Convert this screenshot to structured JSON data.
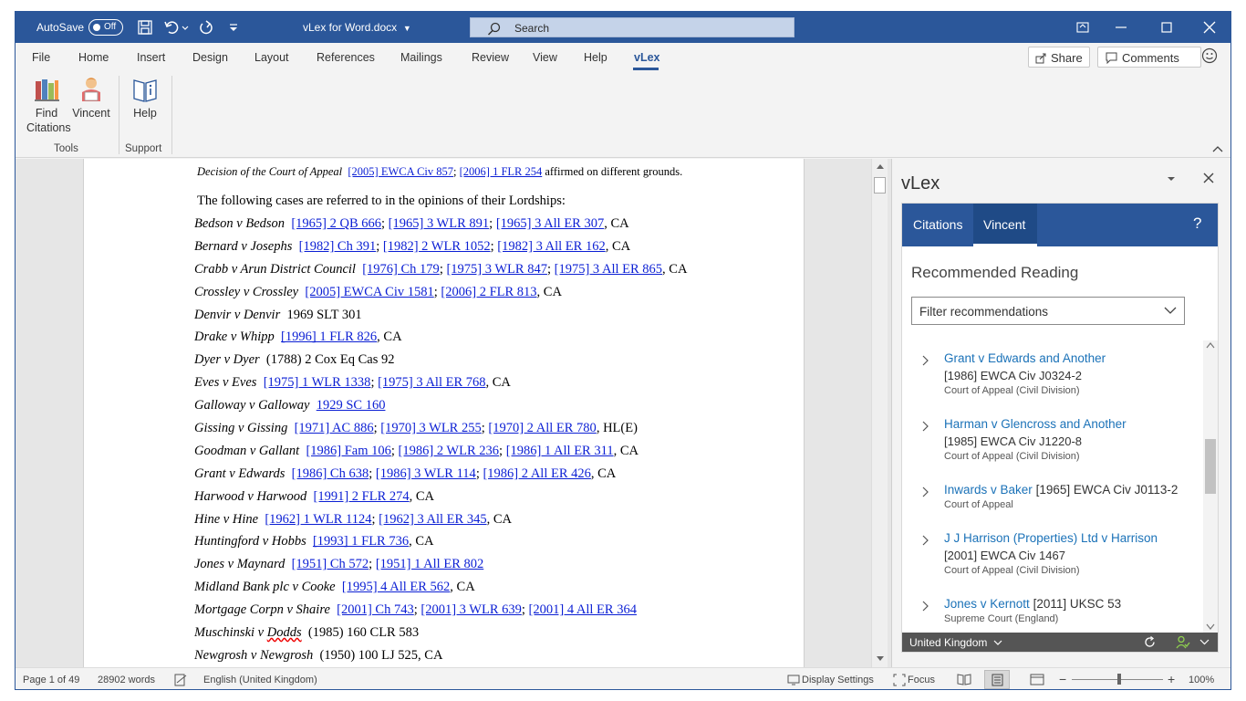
{
  "titlebar": {
    "autosave_label": "AutoSave",
    "autosave_state": "Off",
    "doc_title": "vLex for Word.docx",
    "search_placeholder": "Search"
  },
  "menu": {
    "items": [
      "File",
      "Home",
      "Insert",
      "Design",
      "Layout",
      "References",
      "Mailings",
      "Review",
      "View",
      "Help",
      "vLex"
    ],
    "active": "vLex",
    "share_label": "Share",
    "comments_label": "Comments"
  },
  "ribbon": {
    "find_citations_line1": "Find",
    "find_citations_line2": "Citations",
    "vincent_label": "Vincent",
    "help_label": "Help",
    "group_tools": "Tools",
    "group_support": "Support"
  },
  "document": {
    "decision_prefix": "Decision of the Court of Appeal",
    "decision_cit1": "[2005] EWCA Civ 857",
    "decision_sep": ";",
    "decision_cit2": "[2006] 1 FLR 254",
    "decision_suffix": "affirmed on different grounds.",
    "intro": "The following cases are referred to in the opinions of their Lordships:",
    "cases": [
      {
        "name": "Bedson v Bedson",
        "parts": [
          {
            "t": "[1965] 2 QB 666",
            "link": true
          },
          {
            "t": "; "
          },
          {
            "t": "[1965] 3 WLR 891",
            "link": true
          },
          {
            "t": "; "
          },
          {
            "t": "[1965] 3 All ER 307",
            "link": true
          },
          {
            "t": ", CA"
          }
        ]
      },
      {
        "name": "Bernard v Josephs",
        "parts": [
          {
            "t": "[1982] Ch 391",
            "link": true
          },
          {
            "t": "; "
          },
          {
            "t": "[1982] 2 WLR 1052",
            "link": true
          },
          {
            "t": "; "
          },
          {
            "t": "[1982] 3 All ER 162",
            "link": true
          },
          {
            "t": ", CA"
          }
        ]
      },
      {
        "name": "Crabb v Arun District Council",
        "parts": [
          {
            "t": "[1976] Ch 179",
            "link": true
          },
          {
            "t": "; "
          },
          {
            "t": "[1975] 3 WLR 847",
            "link": true
          },
          {
            "t": "; "
          },
          {
            "t": "[1975] 3 All ER 865",
            "link": true
          },
          {
            "t": ", CA"
          }
        ]
      },
      {
        "name": "Crossley v Crossley",
        "parts": [
          {
            "t": "[2005] EWCA Civ 1581",
            "link": true
          },
          {
            "t": "; "
          },
          {
            "t": "[2006] 2 FLR 813",
            "link": true
          },
          {
            "t": ", CA"
          }
        ]
      },
      {
        "name": "Denvir v Denvir",
        "parts": [
          {
            "t": "1969 SLT 301"
          }
        ]
      },
      {
        "name": "Drake v Whipp",
        "parts": [
          {
            "t": "[1996] 1 FLR 826",
            "link": true
          },
          {
            "t": ", CA"
          }
        ]
      },
      {
        "name": "Dyer v Dyer",
        "parts": [
          {
            "t": "(1788) 2 Cox Eq Cas 92"
          }
        ]
      },
      {
        "name": "Eves v Eves",
        "parts": [
          {
            "t": "[1975] 1 WLR 1338",
            "link": true
          },
          {
            "t": "; "
          },
          {
            "t": "[1975] 3 All ER 768",
            "link": true
          },
          {
            "t": ", CA"
          }
        ]
      },
      {
        "name": "Galloway v Galloway",
        "parts": [
          {
            "t": "1929 SC 160",
            "link": true
          }
        ]
      },
      {
        "name": "Gissing v Gissing",
        "parts": [
          {
            "t": "[1971] AC 886",
            "link": true
          },
          {
            "t": "; "
          },
          {
            "t": "[1970] 3 WLR 255",
            "link": true
          },
          {
            "t": "; "
          },
          {
            "t": "[1970] 2 All ER 780",
            "link": true
          },
          {
            "t": ", HL(E)"
          }
        ]
      },
      {
        "name": "Goodman v Gallant",
        "parts": [
          {
            "t": "[1986] Fam 106",
            "link": true
          },
          {
            "t": "; "
          },
          {
            "t": "[1986] 2 WLR 236",
            "link": true
          },
          {
            "t": "; "
          },
          {
            "t": "[1986] 1 All ER 311",
            "link": true
          },
          {
            "t": ", CA"
          }
        ]
      },
      {
        "name": "Grant v Edwards",
        "parts": [
          {
            "t": "[1986] Ch 638",
            "link": true
          },
          {
            "t": "; "
          },
          {
            "t": "[1986] 3 WLR 114",
            "link": true
          },
          {
            "t": "; "
          },
          {
            "t": "[1986] 2 All ER 426",
            "link": true
          },
          {
            "t": ", CA"
          }
        ]
      },
      {
        "name": "Harwood v Harwood",
        "parts": [
          {
            "t": "[1991] 2 FLR 274",
            "link": true
          },
          {
            "t": ", CA"
          }
        ]
      },
      {
        "name": "Hine v Hine",
        "parts": [
          {
            "t": "[1962] 1 WLR 1124",
            "link": true
          },
          {
            "t": "; "
          },
          {
            "t": "[1962] 3 All ER 345",
            "link": true
          },
          {
            "t": ", CA"
          }
        ]
      },
      {
        "name": "Huntingford v Hobbs",
        "parts": [
          {
            "t": "[1993] 1 FLR 736",
            "link": true
          },
          {
            "t": ", CA"
          }
        ]
      },
      {
        "name": "Jones v Maynard",
        "parts": [
          {
            "t": "[1951] Ch 572",
            "link": true
          },
          {
            "t": "; "
          },
          {
            "t": "[1951] 1 All ER 802",
            "link": true
          }
        ]
      },
      {
        "name": "Midland Bank plc v Cooke",
        "parts": [
          {
            "t": "[1995] 4 All ER 562",
            "link": true
          },
          {
            "t": ", CA"
          }
        ]
      },
      {
        "name": "Mortgage Corpn v Shaire",
        "parts": [
          {
            "t": "[2001] Ch 743",
            "link": true
          },
          {
            "t": "; "
          },
          {
            "t": "[2001] 3 WLR 639",
            "link": true
          },
          {
            "t": "; "
          },
          {
            "t": "[2001] 4 All ER 364",
            "link": true
          }
        ]
      },
      {
        "name": "Muschinski v Dodds",
        "parts": [
          {
            "t": "(1985) 160 CLR 583"
          }
        ]
      },
      {
        "name": "Newgrosh v Newgrosh",
        "parts": [
          {
            "t": "(1950) 100 LJ 525, CA"
          }
        ]
      }
    ]
  },
  "pane": {
    "title": "vLex",
    "tabs": [
      "Citations",
      "Vincent"
    ],
    "active_tab": "Vincent",
    "help": "?",
    "reco_title": "Recommended Reading",
    "filter_label": "Filter recommendations",
    "items": [
      {
        "name": "Grant v Edwards and Another",
        "name_suffix": "",
        "cite": "[1986] EWCA Civ J0324-2",
        "court": "Court of Appeal (Civil Division)"
      },
      {
        "name": "Harman v Glencross and Another",
        "name_suffix": "",
        "cite": "[1985] EWCA Civ J1220-8",
        "court": "Court of Appeal (Civil Division)"
      },
      {
        "name": "Inwards v Baker",
        "name_suffix": "[1965] EWCA Civ J0113-2",
        "cite": "",
        "court": "Court of Appeal"
      },
      {
        "name": "J J Harrison (Properties) Ltd v Harrison",
        "name_suffix": "",
        "cite": "[2001] EWCA Civ 1467",
        "court": "Court of Appeal (Civil Division)"
      },
      {
        "name": "Jones v Kernott",
        "name_suffix": "[2011] UKSC 53",
        "cite": "",
        "court": "Supreme Court (England)"
      }
    ],
    "footer_country": "United Kingdom"
  },
  "status": {
    "page": "Page 1 of 49",
    "words": "28902 words",
    "language": "English (United Kingdom)",
    "display_settings": "Display Settings",
    "focus": "Focus",
    "zoom": "100%"
  },
  "colors": {
    "word_blue": "#2b579a",
    "link_blue": "#0b1fd4",
    "pane_link": "#1b72b8"
  }
}
